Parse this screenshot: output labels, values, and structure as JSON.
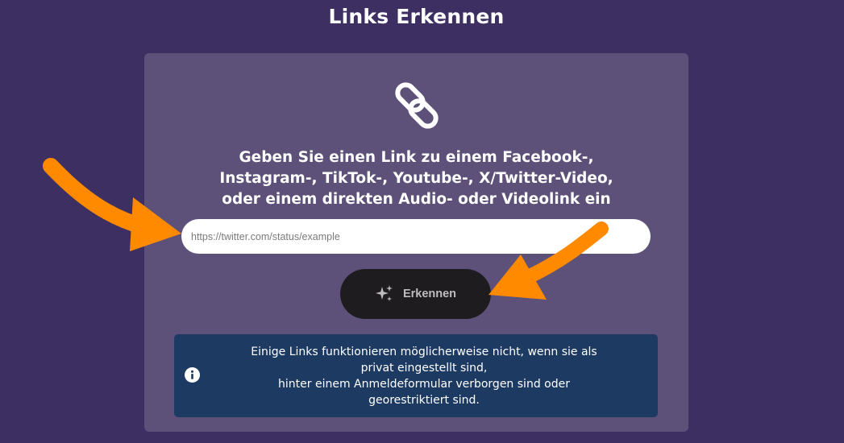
{
  "page": {
    "title": "Links Erkennen"
  },
  "card": {
    "icon": "link-icon",
    "headline_lines": [
      "Geben Sie einen Link zu einem Facebook-,",
      "Instagram-, TikTok-, Youtube-, X/Twitter-Video,",
      "oder einem direkten Audio- oder Videolink ein"
    ],
    "url_input": {
      "value": "",
      "placeholder": "https://twitter.com/status/example"
    },
    "detect_button": {
      "icon": "sparkle-icon",
      "label": "Erkennen"
    },
    "notice": {
      "icon": "info-icon",
      "lines": [
        "Einige Links funktionieren möglicherweise nicht, wenn sie als",
        "privat eingestellt sind,",
        "hinter einem Anmeldeformular verborgen sind oder",
        "georestriktiert sind."
      ]
    }
  },
  "annotations": {
    "arrow_color": "#ff8a00",
    "arrows": [
      "arrow-to-input",
      "arrow-to-button"
    ]
  },
  "colors": {
    "background": "#3e2f63",
    "card": "#5d5179",
    "button": "#1f1c20",
    "notice": "#1d3a63"
  }
}
